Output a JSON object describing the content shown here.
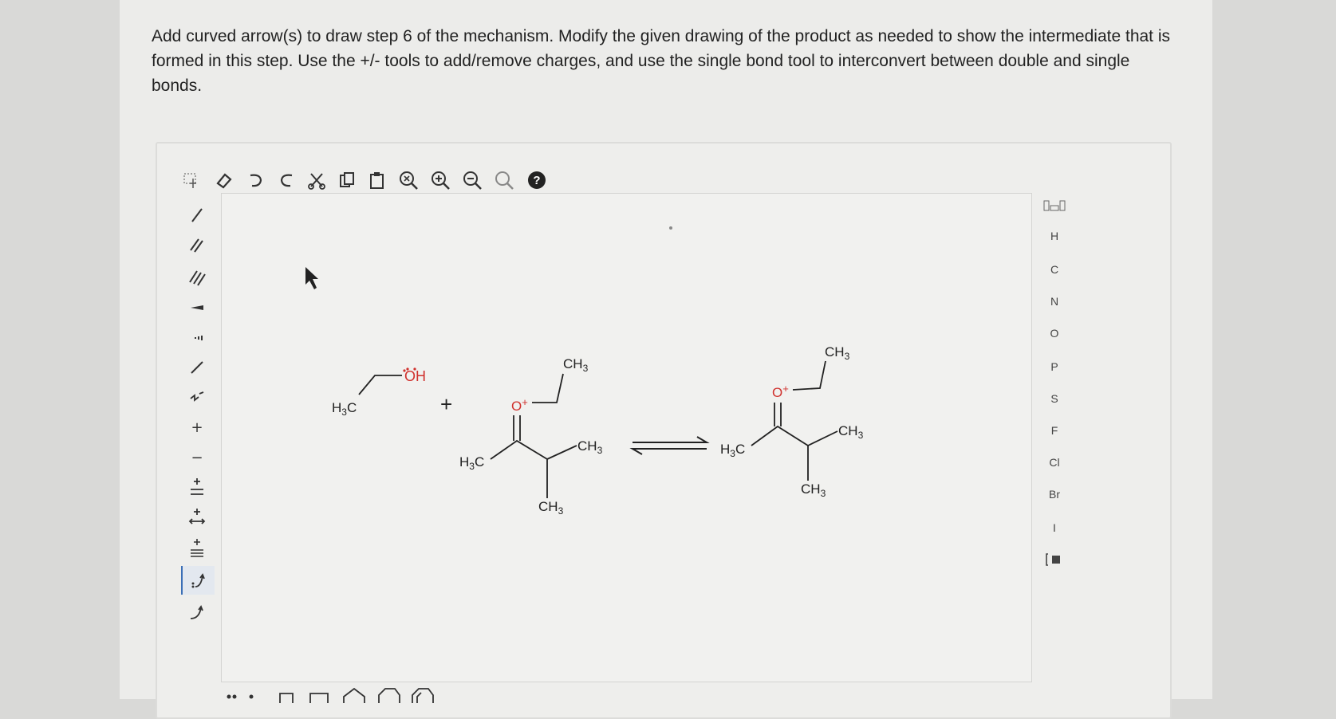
{
  "question": {
    "text": "Add curved arrow(s) to draw step 6 of the mechanism. Modify the given drawing of the product as needed to show the intermediate that is formed in this step. Use the +/- tools to add/remove charges, and use the single bond tool to interconvert between double and single bonds."
  },
  "toolbar": {
    "help_label": "?"
  },
  "left_tools": {
    "plus_label": "+",
    "minus_label": "−"
  },
  "elements": [
    "H",
    "C",
    "N",
    "O",
    "P",
    "S",
    "F",
    "Cl",
    "Br",
    "I"
  ],
  "molecules": {
    "reactant1": {
      "ch3": "H",
      "ch3_sub": "3",
      "ch3_c": "C",
      "oh": "OH"
    },
    "plus_sign": "+",
    "reactant2": {
      "h3c": "H",
      "h3c_sub": "3",
      "h3c_c": "C",
      "ch3_top": "CH",
      "ch3_top_sub": "3",
      "ch3_right": "CH",
      "ch3_right_sub": "3",
      "ch3_bottom": "CH",
      "ch3_bottom_sub": "3",
      "oxygen": "O",
      "charge": "+"
    },
    "product": {
      "h3c": "H",
      "h3c_sub": "3",
      "h3c_c": "C",
      "ch3_top": "CH",
      "ch3_top_sub": "3",
      "ch3_right": "CH",
      "ch3_right_sub": "3",
      "ch3_bottom": "CH",
      "ch3_bottom_sub": "3",
      "oxygen": "O",
      "charge": "+"
    }
  },
  "colors": {
    "oxygen": "#d0312d",
    "accent": "#3b6fb6"
  }
}
